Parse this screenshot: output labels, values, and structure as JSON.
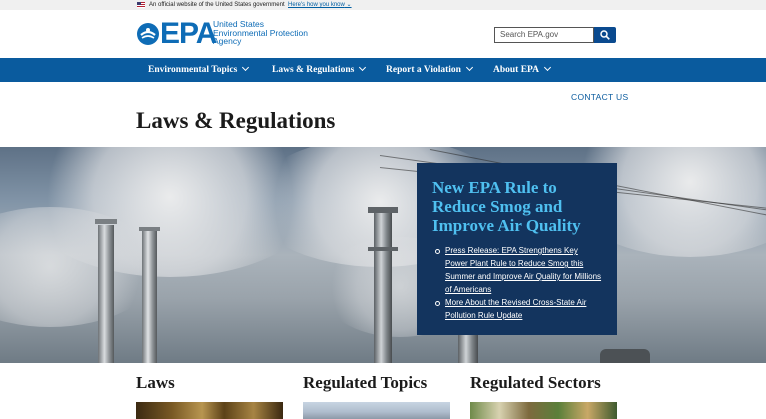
{
  "gov_banner": {
    "text": "An official website of the United States government",
    "link": "Here's how you know"
  },
  "header": {
    "logo_text": "EPA",
    "logo_sub": [
      "United States",
      "Environmental Protection",
      "Agency"
    ],
    "search_placeholder": "Search EPA.gov"
  },
  "nav": {
    "items": [
      {
        "label": "Environmental Topics"
      },
      {
        "label": "Laws & Regulations"
      },
      {
        "label": "Report a Violation"
      },
      {
        "label": "About EPA"
      }
    ]
  },
  "contact_label": "CONTACT US",
  "page_title": "Laws & Regulations",
  "hero": {
    "headline": "New EPA Rule to Reduce Smog and Improve Air Quality",
    "links": [
      "Press Release: EPA Strengthens Key Power Plant Rule to Reduce Smog this Summer and Improve Air Quality for Millions of Americans",
      "More About the Revised Cross-State Air Pollution Rule Update"
    ]
  },
  "sections": [
    {
      "title": "Laws"
    },
    {
      "title": "Regulated Topics"
    },
    {
      "title": "Regulated Sectors"
    }
  ],
  "colors": {
    "brand_blue": "#0a5b9e",
    "card_navy": "#13345e",
    "headline_cyan": "#4fc0f0"
  }
}
